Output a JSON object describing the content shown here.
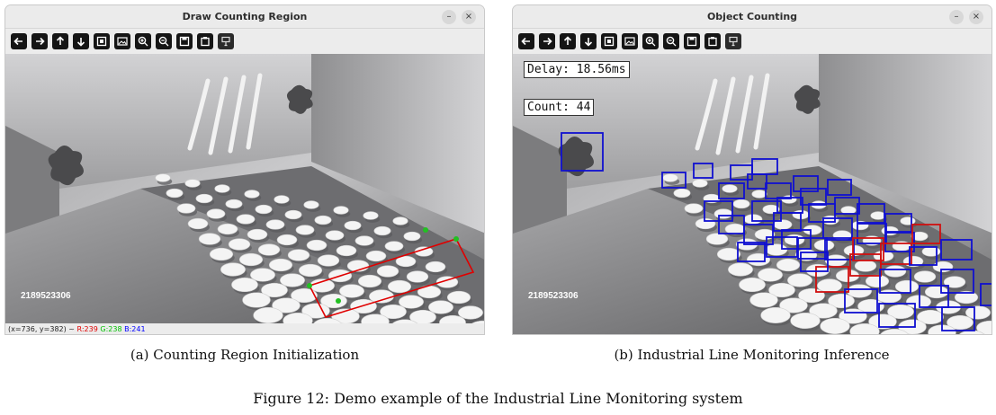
{
  "left_window": {
    "title": "Draw Counting Region",
    "watermark": "2189523306",
    "status": {
      "coords": "(x=736, y=382) ~",
      "r": "R:239",
      "g": "G:238",
      "b": "B:241"
    },
    "region_color": "#e00000",
    "handle_color": "#22c022"
  },
  "right_window": {
    "title": "Object Counting",
    "watermark": "2189523306",
    "delay_text": "Delay: 18.56ms",
    "count_text": "Count: 44",
    "box_colors": {
      "tracked": "#1010d0",
      "counted": "#d01010"
    }
  },
  "toolbar_icons": [
    "arrow-left-icon",
    "arrow-right-icon",
    "arrow-up-icon",
    "arrow-down-icon",
    "zoom-reset-icon",
    "image-icon",
    "zoom-in-icon",
    "zoom-out-icon",
    "save-icon",
    "copy-icon",
    "settings-icon"
  ],
  "window_controls": {
    "minimize": "–",
    "close": "×"
  },
  "captions": {
    "left": "(a) Counting Region Initialization",
    "right": "(b) Industrial Line Monitoring Inference",
    "figure": "Figure 12: Demo example of the Industrial Line Monitoring system"
  }
}
